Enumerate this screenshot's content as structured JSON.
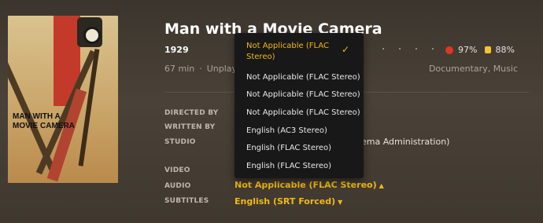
{
  "movie": {
    "title": "Man with a Movie Camera",
    "year": "1929",
    "runtime": "67 min",
    "status": "Unplay",
    "genres": "Documentary, Music",
    "poster_text": "MAN WITH A MOVIE CAMERA"
  },
  "ratings": {
    "critic": "97%",
    "audience": "88%",
    "more_dots": "· · · · ·"
  },
  "labels": {
    "directed_by": "DIRECTED BY",
    "written_by": "WRITTEN BY",
    "studio": "STUDIO",
    "video": "VIDEO",
    "audio": "AUDIO",
    "subtitles": "SUBTITLES"
  },
  "studio_value_partial": "nema Administration)",
  "audio": {
    "current": "Not Applicable (FLAC Stereo)",
    "options": [
      "Not Applicable (FLAC Stereo)",
      "Not Applicable (FLAC Stereo)",
      "Not Applicable (FLAC Stereo)",
      "Not Applicable (FLAC Stereo)",
      "English (AC3 Stereo)",
      "English (FLAC Stereo)",
      "English (FLAC Stereo)"
    ],
    "selected_index": 0
  },
  "subtitles": {
    "current": "English (SRT Forced)"
  },
  "colors": {
    "accent": "#f2b90f",
    "background": "#4a4238",
    "dropdown": "#181818"
  }
}
